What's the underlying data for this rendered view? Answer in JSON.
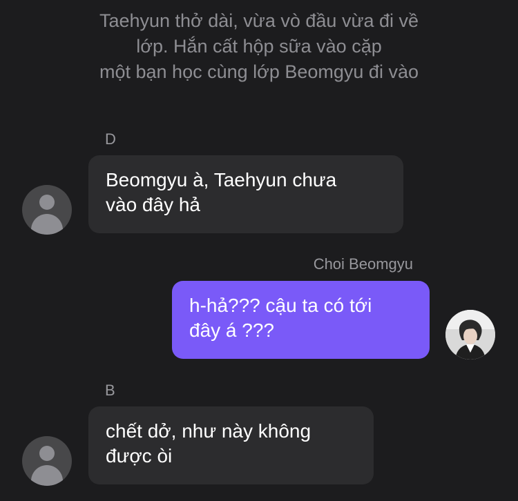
{
  "narration": {
    "lines": [
      "Taehyun thở dài, vừa vò đầu vừa đi về",
      "lớp. Hắn cất hộp sữa vào cặp",
      "một bạn học cùng lớp Beomgyu đi vào"
    ]
  },
  "messages": [
    {
      "sender": "D",
      "direction": "incoming",
      "avatar": "default-user-icon",
      "lines": [
        "Beomgyu à, Taehyun chưa",
        "vào đây hả"
      ]
    },
    {
      "sender": "Choi Beomgyu",
      "direction": "outgoing",
      "avatar": "profile-photo",
      "lines": [
        "h-hả??? cậu ta có tới",
        "đây á ???"
      ]
    },
    {
      "sender": "B",
      "direction": "incoming",
      "avatar": "default-user-icon",
      "lines": [
        "chết dở, như này không",
        "được òi"
      ]
    }
  ],
  "colors": {
    "background": "#1c1c1e",
    "incoming_bubble": "#2c2c2e",
    "outgoing_bubble": "#7a5af8",
    "secondary_text": "#8e8e93"
  }
}
